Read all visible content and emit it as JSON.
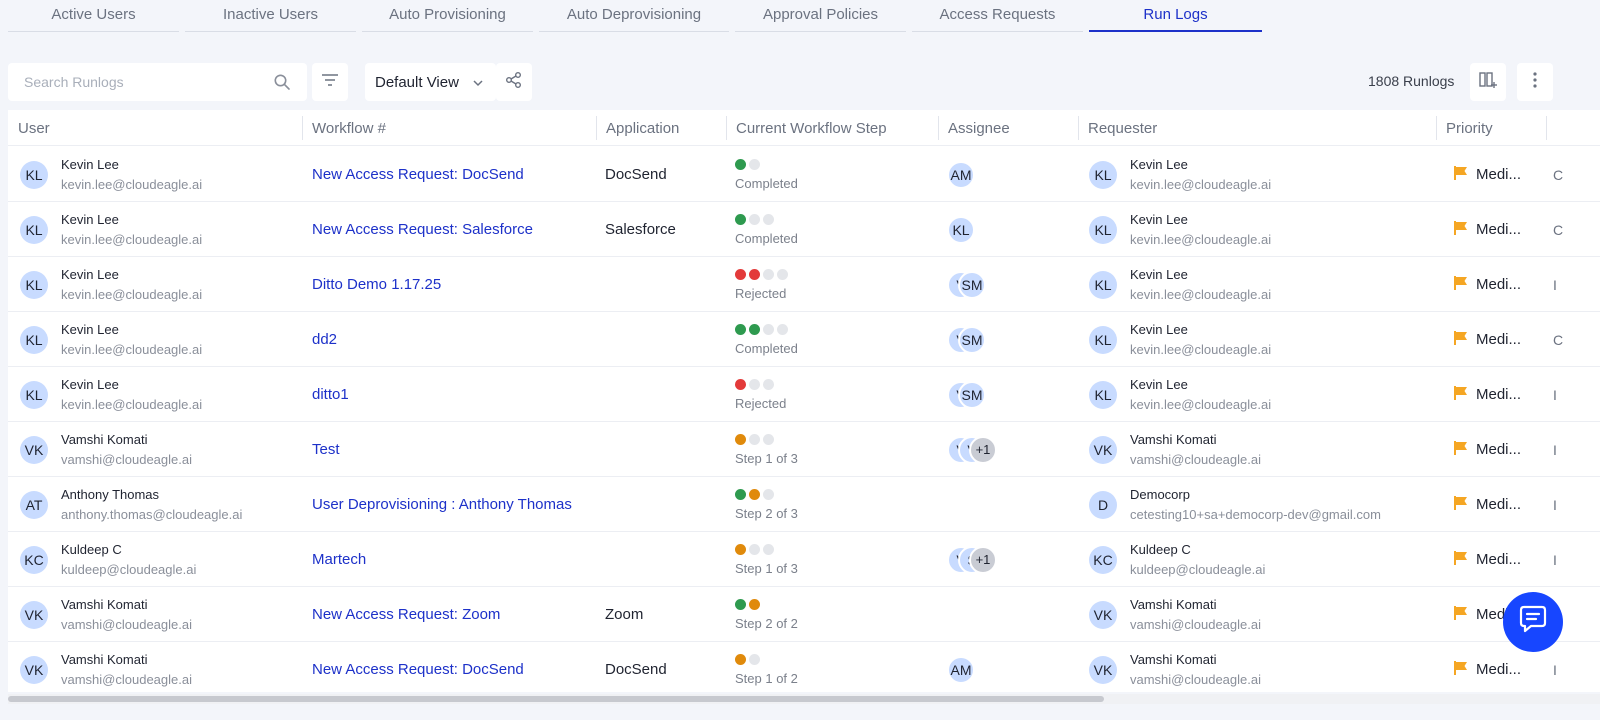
{
  "tabs": [
    {
      "label": "Active Users"
    },
    {
      "label": "Inactive Users"
    },
    {
      "label": "Auto Provisioning"
    },
    {
      "label": "Auto Deprovisioning"
    },
    {
      "label": "Approval Policies"
    },
    {
      "label": "Access Requests"
    },
    {
      "label": "Run Logs"
    }
  ],
  "active_tab": "Run Logs",
  "accent_color": "#1d31c9",
  "toolbar": {
    "search_placeholder": "Search Runlogs",
    "view_label": "Default View",
    "count_label": "1808 Runlogs"
  },
  "columns": [
    "User",
    "Workflow #",
    "Application",
    "Current Workflow Step",
    "Assignee",
    "Requester",
    "Priority"
  ],
  "rows": [
    {
      "user": {
        "initials": "KL",
        "name": "Kevin Lee",
        "email": "kevin.lee@cloudeagle.ai"
      },
      "workflow": "New Access Request: DocSend",
      "application": "DocSend",
      "dots": [
        "green",
        "grey"
      ],
      "step_label": "Completed",
      "assignees": [
        "AM"
      ],
      "requester": {
        "initials": "KL",
        "name": "Kevin Lee",
        "email": "kevin.lee@cloudeagle.ai"
      },
      "priority": "Medi...",
      "extra": "C"
    },
    {
      "user": {
        "initials": "KL",
        "name": "Kevin Lee",
        "email": "kevin.lee@cloudeagle.ai"
      },
      "workflow": "New Access Request: Salesforce",
      "application": "Salesforce",
      "dots": [
        "green",
        "grey",
        "grey"
      ],
      "step_label": "Completed",
      "assignees": [
        "KL"
      ],
      "requester": {
        "initials": "KL",
        "name": "Kevin Lee",
        "email": "kevin.lee@cloudeagle.ai"
      },
      "priority": "Medi...",
      "extra": "C"
    },
    {
      "user": {
        "initials": "KL",
        "name": "Kevin Lee",
        "email": "kevin.lee@cloudeagle.ai"
      },
      "workflow": "Ditto Demo 1.17.25",
      "application": "",
      "dots": [
        "red",
        "red",
        "grey",
        "grey"
      ],
      "step_label": "Rejected",
      "assignees": [
        "V",
        "SM"
      ],
      "requester": {
        "initials": "KL",
        "name": "Kevin Lee",
        "email": "kevin.lee@cloudeagle.ai"
      },
      "priority": "Medi...",
      "extra": "I"
    },
    {
      "user": {
        "initials": "KL",
        "name": "Kevin Lee",
        "email": "kevin.lee@cloudeagle.ai"
      },
      "workflow": "dd2",
      "application": "",
      "dots": [
        "green",
        "green",
        "grey",
        "grey"
      ],
      "step_label": "Completed",
      "assignees": [
        "V",
        "SM"
      ],
      "requester": {
        "initials": "KL",
        "name": "Kevin Lee",
        "email": "kevin.lee@cloudeagle.ai"
      },
      "priority": "Medi...",
      "extra": "C"
    },
    {
      "user": {
        "initials": "KL",
        "name": "Kevin Lee",
        "email": "kevin.lee@cloudeagle.ai"
      },
      "workflow": "ditto1",
      "application": "",
      "dots": [
        "red",
        "grey",
        "grey"
      ],
      "step_label": "Rejected",
      "assignees": [
        "V",
        "SM"
      ],
      "requester": {
        "initials": "KL",
        "name": "Kevin Lee",
        "email": "kevin.lee@cloudeagle.ai"
      },
      "priority": "Medi...",
      "extra": "I"
    },
    {
      "user": {
        "initials": "VK",
        "name": "Vamshi Komati",
        "email": "vamshi@cloudeagle.ai"
      },
      "workflow": "Test",
      "application": "",
      "dots": [
        "orange",
        "grey",
        "grey"
      ],
      "step_label": "Step 1 of 3",
      "assignees": [
        "V",
        "V",
        "+1"
      ],
      "requester": {
        "initials": "VK",
        "name": "Vamshi Komati",
        "email": "vamshi@cloudeagle.ai"
      },
      "priority": "Medi...",
      "extra": "I"
    },
    {
      "user": {
        "initials": "AT",
        "name": "Anthony Thomas",
        "email": "anthony.thomas@cloudeagle.ai"
      },
      "workflow": "User Deprovisioning : Anthony Thomas",
      "application": "",
      "dots": [
        "green",
        "orange",
        "grey"
      ],
      "step_label": "Step 2 of 3",
      "assignees": [],
      "requester": {
        "initials": "D",
        "name": "Democorp",
        "email": "cetesting10+sa+democorp-dev@gmail.com"
      },
      "priority": "Medi...",
      "extra": "I"
    },
    {
      "user": {
        "initials": "KC",
        "name": "Kuldeep C",
        "email": "kuldeep@cloudeagle.ai"
      },
      "workflow": "Martech",
      "application": "",
      "dots": [
        "orange",
        "grey",
        "grey"
      ],
      "step_label": "Step 1 of 3",
      "assignees": [
        "V",
        "S",
        "+1"
      ],
      "requester": {
        "initials": "KC",
        "name": "Kuldeep C",
        "email": "kuldeep@cloudeagle.ai"
      },
      "priority": "Medi...",
      "extra": "I"
    },
    {
      "user": {
        "initials": "VK",
        "name": "Vamshi Komati",
        "email": "vamshi@cloudeagle.ai"
      },
      "workflow": "New Access Request: Zoom",
      "application": "Zoom",
      "dots": [
        "green",
        "orange"
      ],
      "step_label": "Step 2 of 2",
      "assignees": [],
      "requester": {
        "initials": "VK",
        "name": "Vamshi Komati",
        "email": "vamshi@cloudeagle.ai"
      },
      "priority": "Medi",
      "extra": ""
    },
    {
      "user": {
        "initials": "VK",
        "name": "Vamshi Komati",
        "email": "vamshi@cloudeagle.ai"
      },
      "workflow": "New Access Request: DocSend",
      "application": "DocSend",
      "dots": [
        "orange",
        "grey"
      ],
      "step_label": "Step 1 of 2",
      "assignees": [
        "AM"
      ],
      "requester": {
        "initials": "VK",
        "name": "Vamshi Komati",
        "email": "vamshi@cloudeagle.ai"
      },
      "priority": "Medi...",
      "extra": "I"
    }
  ],
  "priority_flag_color": "#f5a623",
  "horizontal_scroll_fraction": 0.69
}
